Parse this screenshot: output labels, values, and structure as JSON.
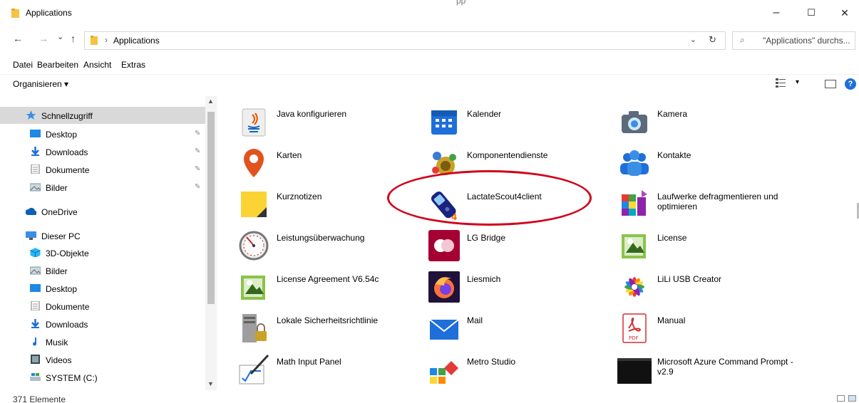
{
  "window": {
    "title": "Applications",
    "title_center": "pp",
    "controls": {
      "minimize": "–",
      "maximize": "☐",
      "close": "✕"
    }
  },
  "address": {
    "back": "←",
    "forward": "→",
    "recent": "⌄",
    "up": "↑",
    "separator": "›",
    "path": "Applications",
    "dropdown": "⌄",
    "refresh": "↻",
    "search_placeholder": "\"Applications\" durchs...",
    "search_icon": "⌕"
  },
  "menu": [
    "Datei",
    "Bearbeiten",
    "Ansicht",
    "Extras"
  ],
  "command": {
    "organize": "Organisieren ▾",
    "view_dropdown": "▾",
    "help": "?"
  },
  "nav": [
    {
      "label": "Schnellzugriff",
      "icon": "star-icon",
      "level": 1,
      "selected": true,
      "pinned": false
    },
    {
      "label": "Desktop",
      "icon": "desktop-icon",
      "level": 2,
      "pinned": true
    },
    {
      "label": "Downloads",
      "icon": "download-icon",
      "level": 2,
      "pinned": true
    },
    {
      "label": "Dokumente",
      "icon": "document-icon",
      "level": 2,
      "pinned": true
    },
    {
      "label": "Bilder",
      "icon": "pictures-icon",
      "level": 2,
      "pinned": true
    },
    {
      "label": "OneDrive",
      "icon": "cloud-icon",
      "level": 1,
      "pinned": false
    },
    {
      "label": "Dieser PC",
      "icon": "pc-icon",
      "level": 1,
      "pinned": false
    },
    {
      "label": "3D-Objekte",
      "icon": "cube-icon",
      "level": 2,
      "pinned": false
    },
    {
      "label": "Bilder",
      "icon": "pictures-icon",
      "level": 2,
      "pinned": false
    },
    {
      "label": "Desktop",
      "icon": "desktop-icon",
      "level": 2,
      "pinned": false
    },
    {
      "label": "Dokumente",
      "icon": "document-icon",
      "level": 2,
      "pinned": false
    },
    {
      "label": "Downloads",
      "icon": "download-icon",
      "level": 2,
      "pinned": false
    },
    {
      "label": "Musik",
      "icon": "music-icon",
      "level": 2,
      "pinned": false
    },
    {
      "label": "Videos",
      "icon": "video-icon",
      "level": 2,
      "pinned": false
    },
    {
      "label": "SYSTEM (C:)",
      "icon": "drive-icon",
      "level": 2,
      "pinned": false
    }
  ],
  "pin_glyph": "✎",
  "apps": [
    {
      "label": "Java konfigurieren",
      "icon": "java-icon"
    },
    {
      "label": "Kalender",
      "icon": "calendar-icon"
    },
    {
      "label": "Kamera",
      "icon": "camera-icon"
    },
    {
      "label": "Karten",
      "icon": "map-pin-icon"
    },
    {
      "label": "Komponentendienste",
      "icon": "component-services-icon"
    },
    {
      "label": "Kontakte",
      "icon": "contacts-icon"
    },
    {
      "label": "Kurznotizen",
      "icon": "sticky-notes-icon"
    },
    {
      "label": "LactateScout4client",
      "icon": "lactate-meter-icon"
    },
    {
      "label": "Laufwerke defragmentieren und optimieren",
      "icon": "defrag-icon"
    },
    {
      "label": "Leistungsüberwachung",
      "icon": "gauge-icon"
    },
    {
      "label": "LG Bridge",
      "icon": "lg-bridge-icon"
    },
    {
      "label": "License",
      "icon": "license-doc-icon"
    },
    {
      "label": "License Agreement V6.54c",
      "icon": "license-doc-icon"
    },
    {
      "label": "Liesmich",
      "icon": "firefox-icon"
    },
    {
      "label": "LiLi USB Creator",
      "icon": "lili-icon"
    },
    {
      "label": "Lokale Sicherheitsrichtlinie",
      "icon": "server-lock-icon"
    },
    {
      "label": "Mail",
      "icon": "mail-icon"
    },
    {
      "label": "Manual",
      "icon": "pdf-icon"
    },
    {
      "label": "Math Input Panel",
      "icon": "math-pen-icon"
    },
    {
      "label": "Metro Studio",
      "icon": "metro-studio-icon"
    },
    {
      "label": "Microsoft Azure Command Prompt - v2.9",
      "icon": "terminal-icon"
    }
  ],
  "status": {
    "count": "371 Elemente"
  },
  "colors": {
    "selection": "#d9d9d9",
    "accent": "#1e6fd9",
    "annotation": "#d0021b",
    "folder": "#f5c242"
  }
}
